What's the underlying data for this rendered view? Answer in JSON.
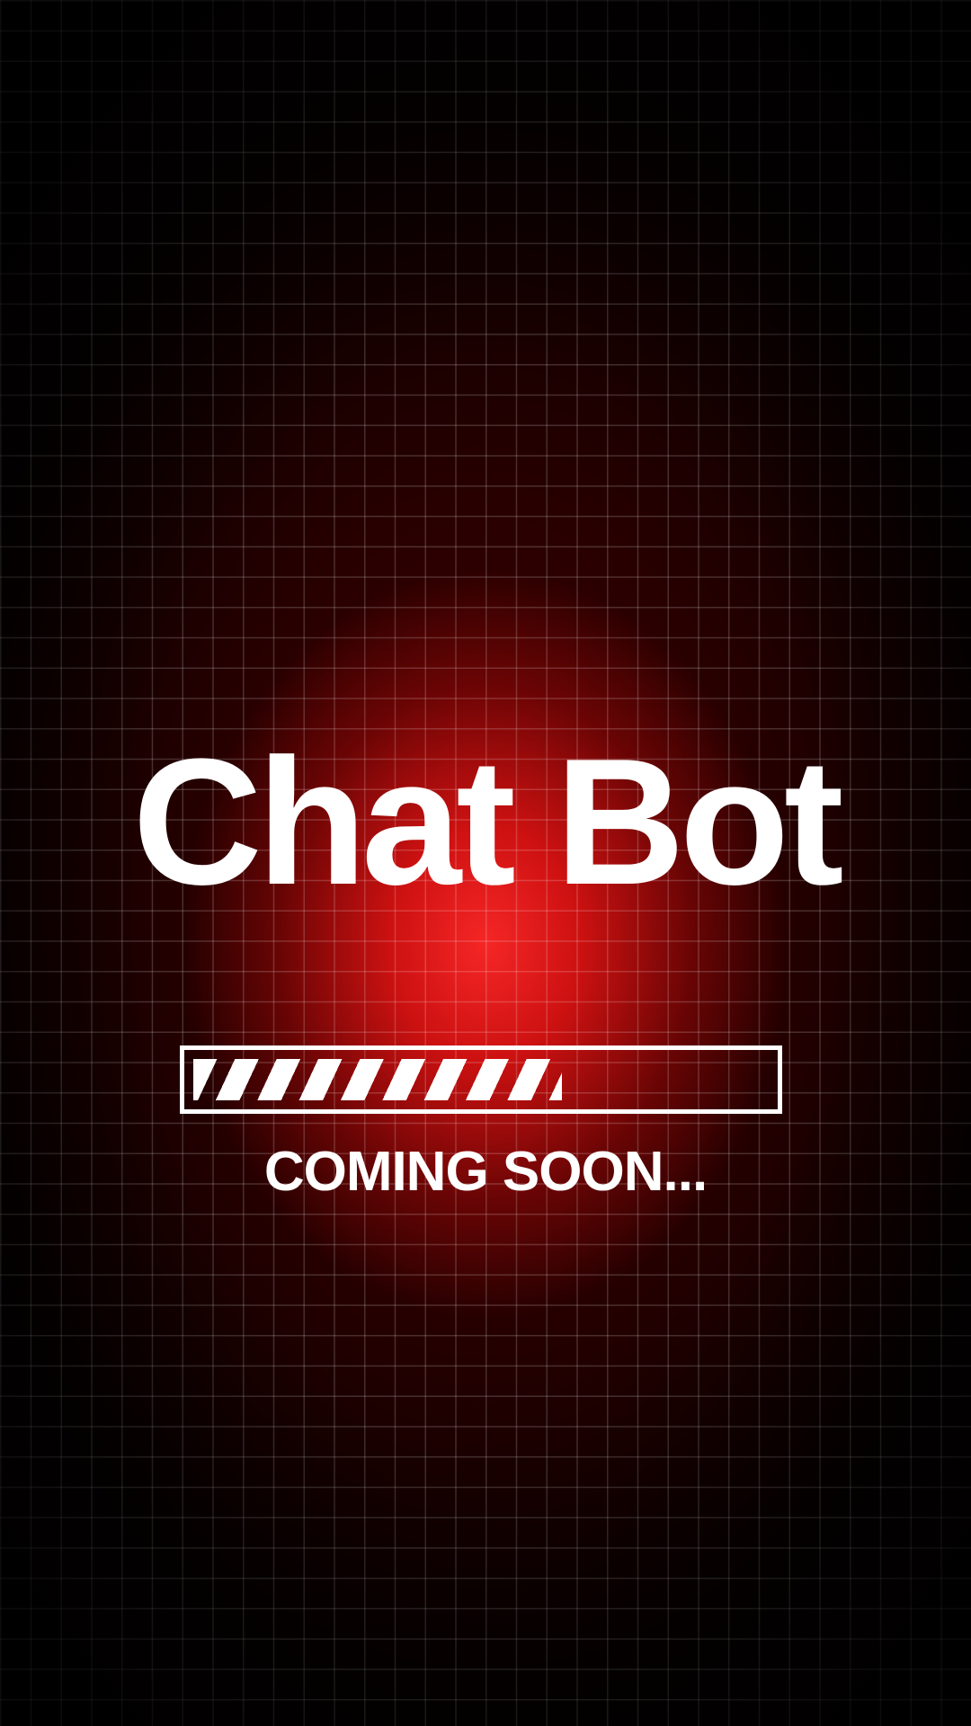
{
  "title": "Chat Bot",
  "progress": {
    "fraction": 0.64
  },
  "status_text": "COMING SOON...",
  "colors": {
    "background": "#000000",
    "glow": "#ff1a1a",
    "text": "#ffffff",
    "grid": "#ffffff"
  }
}
